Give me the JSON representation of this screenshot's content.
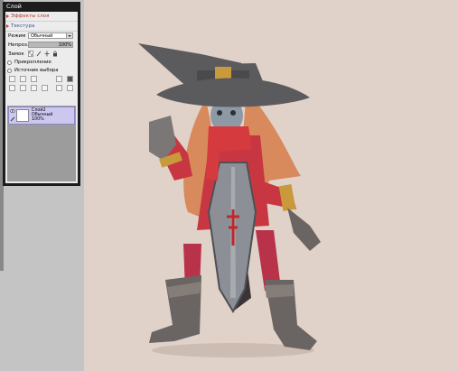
{
  "panel": {
    "title": "Слой",
    "links": [
      {
        "label": "Эффекты слоя",
        "color": "red"
      },
      {
        "label": "Текстура",
        "color": "blue"
      }
    ],
    "mode_label": "Режим",
    "mode_value": "Обычный",
    "opacity_label": "Непроз.",
    "opacity_value": "100%",
    "opacity_fraction": 1.0,
    "lock_label": "Замок",
    "checkboxes": [
      {
        "label": "Прикрепление"
      },
      {
        "label": "Источник выбора"
      }
    ],
    "layer": {
      "name": "Слой2",
      "mode": "Обычный",
      "opacity": "100%"
    }
  },
  "colors": {
    "canvas_bg": "#e0d2c9",
    "panel_bg": "#1c1c1c",
    "layer_selected": "#cbc7ef",
    "cape": "#d43a3e",
    "hat": "#5b5b5d",
    "hair": "#d98a5c",
    "gold": "#c89a3c"
  }
}
